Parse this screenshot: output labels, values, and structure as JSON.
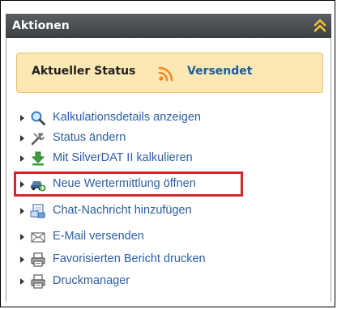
{
  "panel": {
    "title": "Aktionen",
    "collapse_icon": "double-chevron-up-icon",
    "header_color": "#4a4e52",
    "collapse_color": "#f2c232"
  },
  "status": {
    "label": "Aktueller Status",
    "icon": "rss-feed-icon",
    "value": "Versendet",
    "box_color": "#fbe8b4",
    "value_color": "#1e5a96"
  },
  "actions": [
    {
      "label": "Kalkulationsdetails anzeigen",
      "icon": "magnifier-icon"
    },
    {
      "label": "Status ändern",
      "icon": "tools-icon"
    },
    {
      "label": "Mit SilverDAT II kalkulieren",
      "icon": "download-arrow-icon"
    },
    {
      "label": "Neue Wertermittlung öffnen",
      "icon": "car-add-icon",
      "highlighted": true
    },
    {
      "label": "Chat-Nachricht hinzufügen",
      "icon": "chat-document-icon"
    },
    {
      "label": "E-Mail versenden",
      "icon": "envelope-icon"
    },
    {
      "label": "Favorisierten Bericht drucken",
      "icon": "printer-icon"
    },
    {
      "label": "Druckmanager",
      "icon": "printer-icon"
    }
  ],
  "highlight_color": "#d9232e",
  "link_color": "#2b5fa6"
}
